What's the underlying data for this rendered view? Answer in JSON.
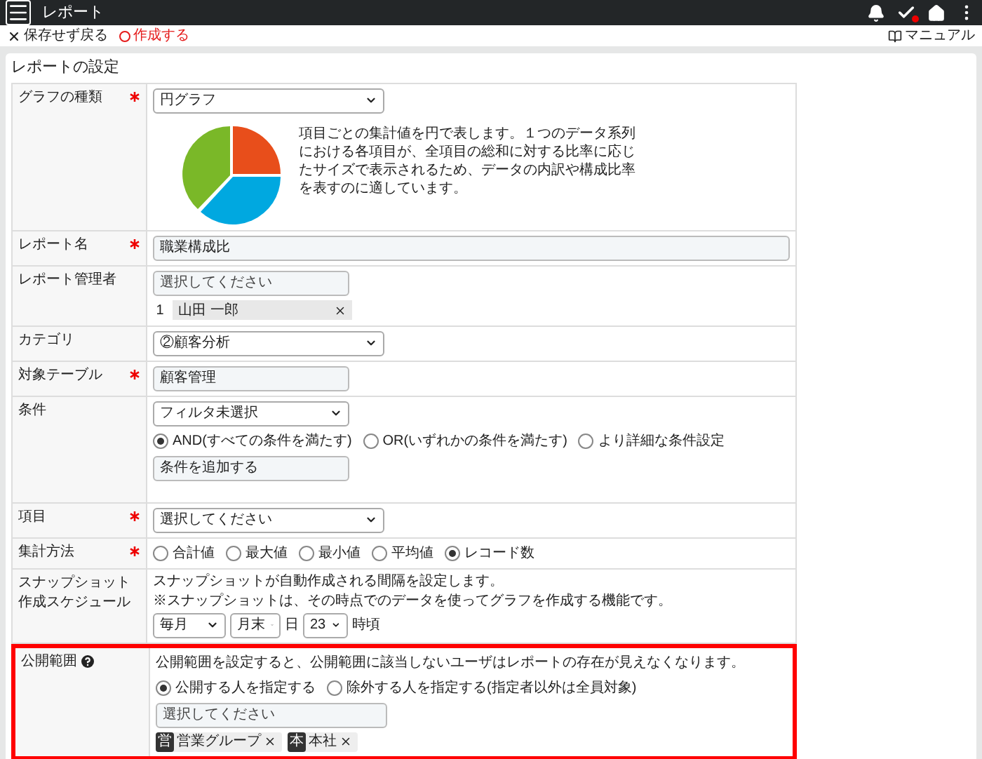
{
  "header": {
    "title": "レポート"
  },
  "toolbar": {
    "back": "保存せず戻る",
    "create": "作成する",
    "manual": "マニュアル"
  },
  "section_title": "レポートの設定",
  "fields": [
    {
      "kind": "chart_select",
      "label": "グラフの種類",
      "required": true,
      "value": "円グラフ",
      "description": "項目ごとの集計値を円で表します。１つのデータ系列における各項目が、全項目の総和に対する比率に応じたサイズで表示されるため、データの内訳や構成比率を表すのに適しています。"
    },
    {
      "kind": "text",
      "label": "レポート名",
      "required": true,
      "value": "職業構成比"
    },
    {
      "kind": "user_picker",
      "label": "レポート管理者",
      "required": false,
      "placeholder": "選択してください",
      "entries": [
        {
          "index": "1",
          "name": "山田 一郎"
        }
      ]
    },
    {
      "kind": "select",
      "label": "カテゴリ",
      "required": false,
      "value": "②顧客分析"
    },
    {
      "kind": "short_text",
      "label": "対象テーブル",
      "required": true,
      "value": "顧客管理"
    },
    {
      "kind": "conditions",
      "label": "条件",
      "required": false,
      "filter": "フィルタ未選択",
      "options": [
        {
          "label": "AND(すべての条件を満たす)",
          "selected": true
        },
        {
          "label": "OR(いずれかの条件を満たす)",
          "selected": false
        },
        {
          "label": "より詳細な条件設定",
          "selected": false
        }
      ],
      "add_button": "条件を追加する"
    },
    {
      "kind": "select",
      "label": "項目",
      "required": true,
      "value": "選択してください"
    },
    {
      "kind": "radio",
      "label": "集計方法",
      "required": true,
      "options": [
        {
          "label": "合計値",
          "selected": false
        },
        {
          "label": "最大値",
          "selected": false
        },
        {
          "label": "最小値",
          "selected": false
        },
        {
          "label": "平均値",
          "selected": false
        },
        {
          "label": "レコード数",
          "selected": true
        }
      ]
    },
    {
      "kind": "schedule",
      "label_lines": [
        "スナップショット",
        "作成スケジュール"
      ],
      "required": false,
      "description_lines": [
        "スナップショットが自動作成される間隔を設定します。",
        "※スナップショットは、その時点でのデータを使ってグラフを作成する機能です。"
      ],
      "frequency": "毎月",
      "day": "月末",
      "day_unit": "日",
      "hour": "23",
      "hour_unit": "時頃"
    },
    {
      "kind": "visibility",
      "label": "公開範囲",
      "required": false,
      "help": true,
      "highlighted": true,
      "description": "公開範囲を設定すると、公開範囲に該当しないユーザはレポートの存在が見えなくなります。",
      "options": [
        {
          "label": "公開する人を指定する",
          "selected": true
        },
        {
          "label": "除外する人を指定する(指定者以外は全員対象)",
          "selected": false
        }
      ],
      "placeholder": "選択してください",
      "tags": [
        {
          "badge": "営",
          "name": "営業グループ"
        },
        {
          "badge": "本",
          "name": "本社"
        }
      ]
    }
  ]
}
